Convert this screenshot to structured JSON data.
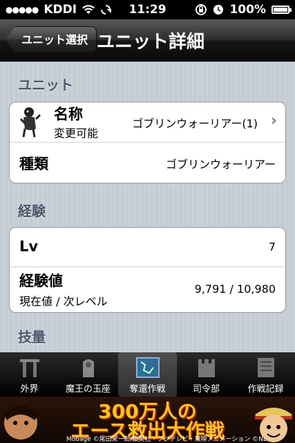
{
  "status_bar": {
    "carrier": "KDDI",
    "time": "11:29",
    "battery": "100%"
  },
  "nav": {
    "back_label": "ユニット選択",
    "title": "ユニット詳細"
  },
  "sections": {
    "unit": {
      "header": "ユニット",
      "name_label": "名称",
      "name_sub": "変更可能",
      "name_value": "ゴブリンウォーリアー(1)",
      "type_label": "種類",
      "type_value": "ゴブリンウォーリアー"
    },
    "experience": {
      "header": "経験",
      "lv_label": "Lv",
      "lv_value": "7",
      "exp_label": "経験値",
      "exp_sub": "現在値 / 次レベル",
      "exp_value": "9,791 / 10,980"
    },
    "skill": {
      "header": "技量"
    }
  },
  "tabs": [
    {
      "label": "外界",
      "icon": "gate-icon"
    },
    {
      "label": "魔王の玉座",
      "icon": "throne-icon"
    },
    {
      "label": "奪還作戦",
      "icon": "map-icon"
    },
    {
      "label": "司令部",
      "icon": "castle-icon"
    },
    {
      "label": "作戦記録",
      "icon": "record-icon"
    }
  ],
  "banner": {
    "line1": "300万人の",
    "line2": "エース救出大作戦",
    "credit": "Mobage ©尾田栄一郎/集英社・フジテレビ・東映アニメーション ©NBGI"
  }
}
